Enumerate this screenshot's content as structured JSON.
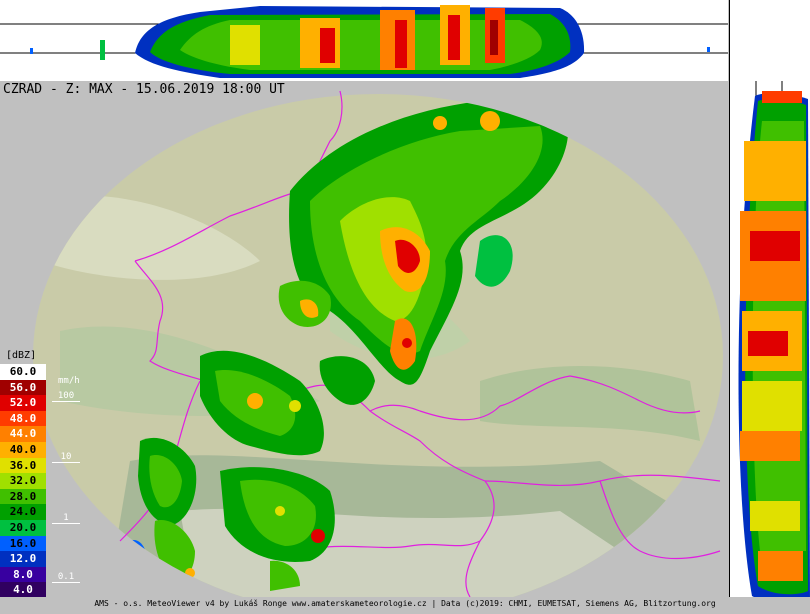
{
  "title": "CZRAD - Z: MAX - 15.06.2019 18:00 UT",
  "footer": "AMS - o.s. MeteoViewer v4 by Lukáš Ronge www.amaterskameteorologie.cz | Data (c)2019: CHMI, EUMETSAT, Siemens AG, Blitzortung.org",
  "legend": {
    "unit": "[dBZ]",
    "rain_unit": "mm/h",
    "rows": [
      {
        "label": "60.0",
        "color": "#ffffff",
        "text": "#000000"
      },
      {
        "label": "56.0",
        "color": "#a00000",
        "text": "#ffffff"
      },
      {
        "label": "52.0",
        "color": "#e00000",
        "text": "#ffffff"
      },
      {
        "label": "48.0",
        "color": "#ff3c00",
        "text": "#ffffff"
      },
      {
        "label": "44.0",
        "color": "#ff8000",
        "text": "#ffffff"
      },
      {
        "label": "40.0",
        "color": "#ffb000",
        "text": "#000000"
      },
      {
        "label": "36.0",
        "color": "#e0e000",
        "text": "#000000"
      },
      {
        "label": "32.0",
        "color": "#a0e000",
        "text": "#000000"
      },
      {
        "label": "28.0",
        "color": "#40c000",
        "text": "#000000"
      },
      {
        "label": "24.0",
        "color": "#00a000",
        "text": "#000000"
      },
      {
        "label": "20.0",
        "color": "#00c040",
        "text": "#000000"
      },
      {
        "label": "16.0",
        "color": "#0060ff",
        "text": "#000000"
      },
      {
        "label": "12.0",
        "color": "#0030c0",
        "text": "#ffffff"
      },
      {
        "label": "8.0",
        "color": "#3800a0",
        "text": "#ffffff"
      },
      {
        "label": "4.0",
        "color": "#300060",
        "text": "#ffffff"
      }
    ],
    "rain_ticks": [
      "100",
      "10",
      "1",
      "0.1"
    ]
  }
}
